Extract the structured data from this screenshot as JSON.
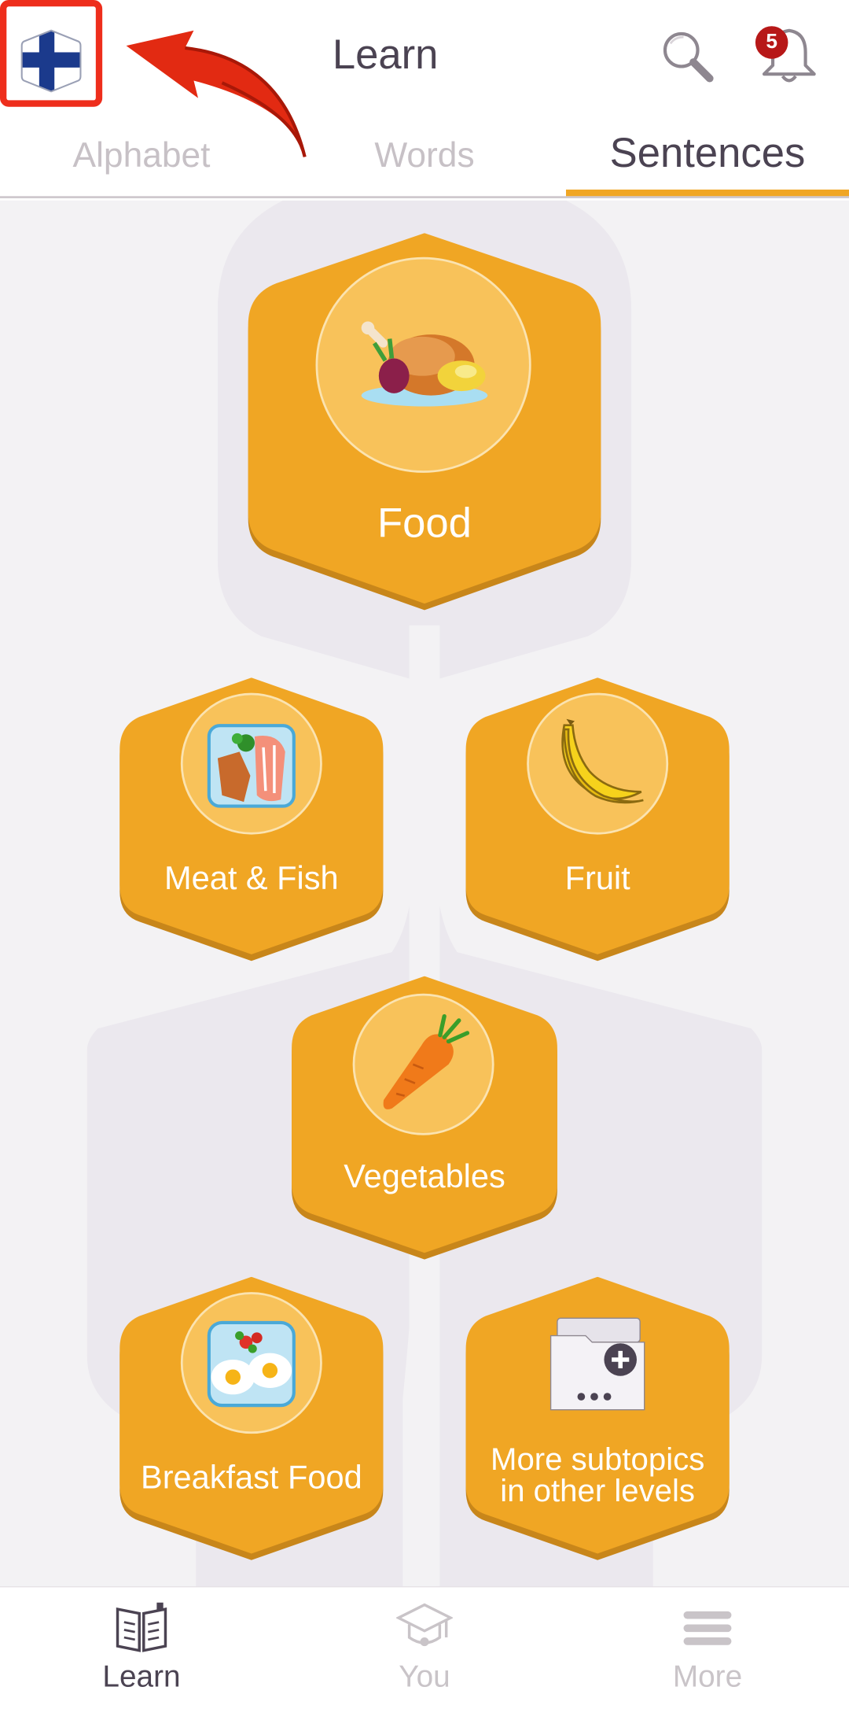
{
  "header": {
    "title": "Learn",
    "notification_count": "5"
  },
  "tabs": [
    {
      "label": "Alphabet",
      "active": false
    },
    {
      "label": "Words",
      "active": false
    },
    {
      "label": "Sentences",
      "active": true
    }
  ],
  "topics": {
    "food": {
      "label": "Food",
      "icon": "roast-chicken-icon"
    },
    "meat_fish": {
      "label": "Meat & Fish",
      "icon": "meat-fish-icon"
    },
    "fruit": {
      "label": "Fruit",
      "icon": "banana-icon"
    },
    "vegetables": {
      "label": "Vegetables",
      "icon": "carrot-icon"
    },
    "breakfast": {
      "label": "Breakfast Food",
      "icon": "fried-eggs-icon"
    },
    "more": {
      "label": "More subtopics in other levels",
      "icon": "folder-plus-icon"
    }
  },
  "bottom_nav": [
    {
      "label": "Learn",
      "icon": "book-icon",
      "active": true
    },
    {
      "label": "You",
      "icon": "graduation-cap-icon",
      "active": false
    },
    {
      "label": "More",
      "icon": "menu-icon",
      "active": false
    }
  ],
  "colors": {
    "accent": "#f0a624",
    "highlight_box": "#ee2e1c",
    "badge": "#b71818",
    "text_dark": "#4b4352"
  }
}
